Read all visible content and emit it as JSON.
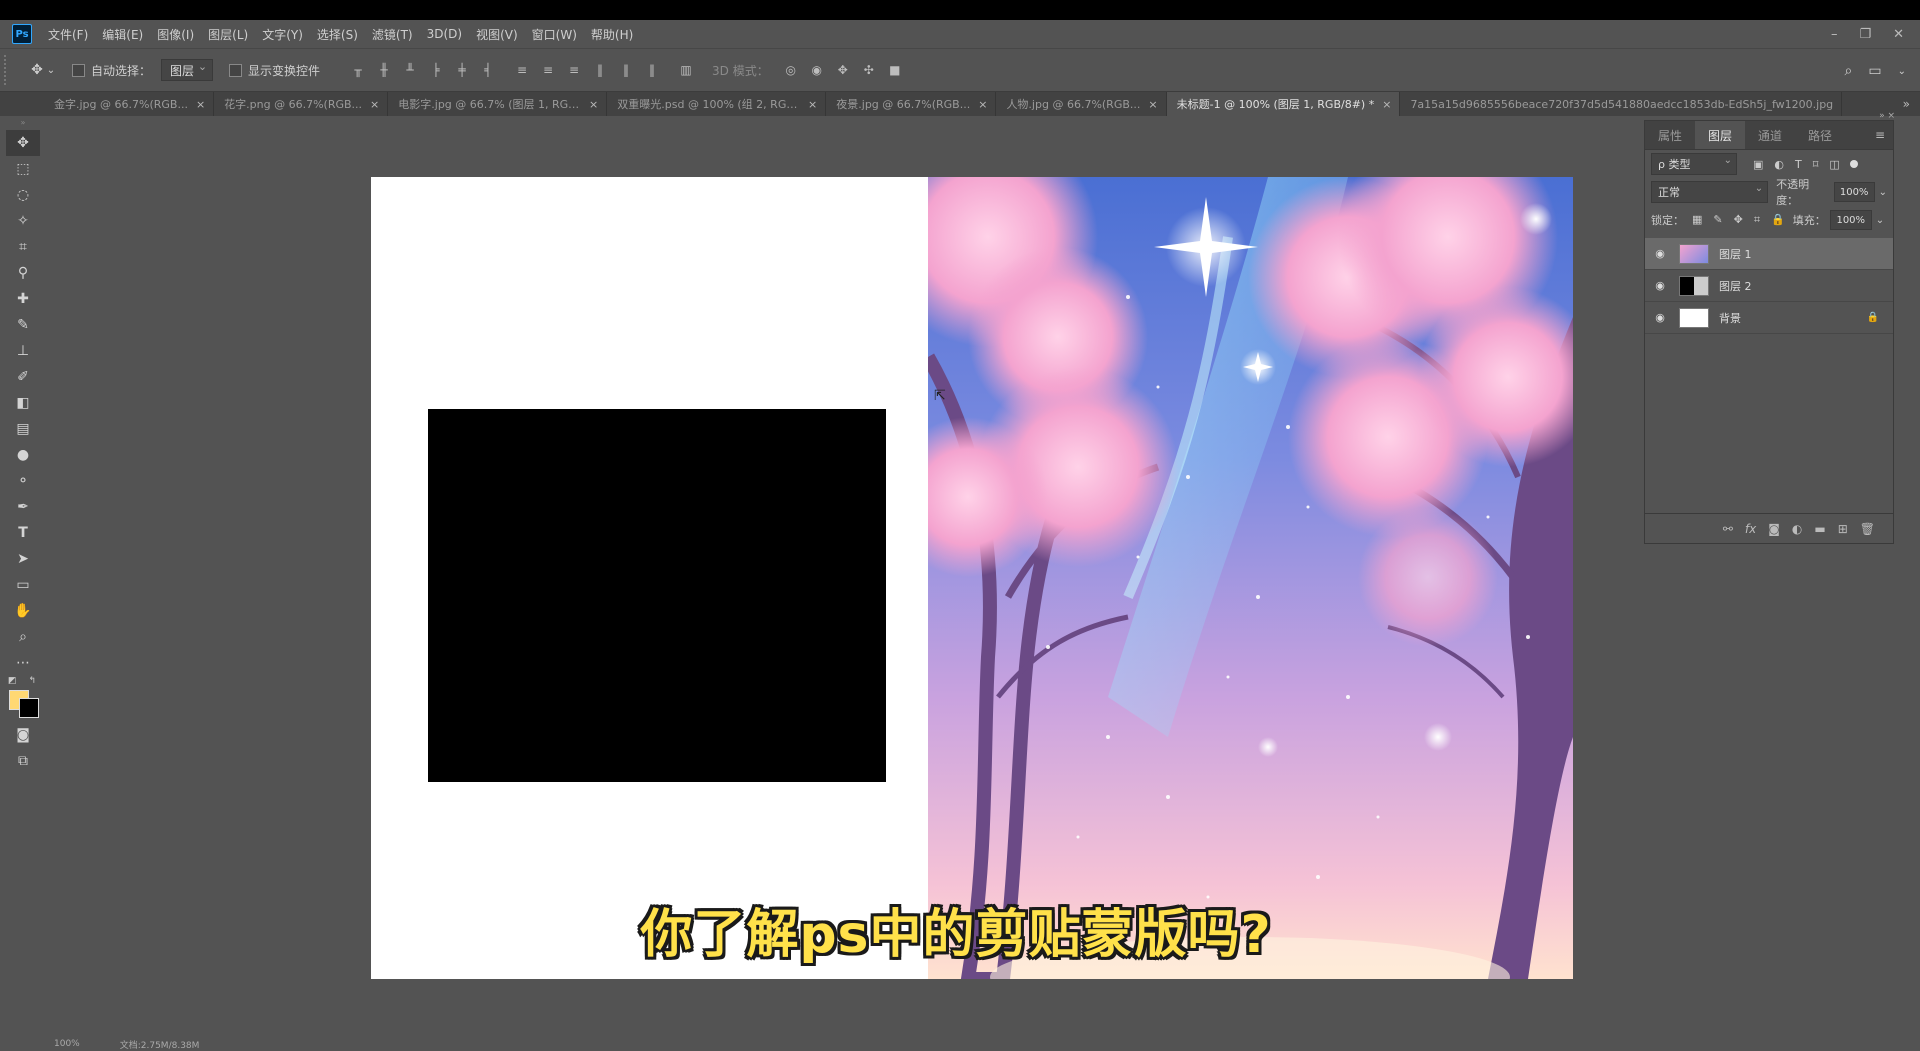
{
  "app": {
    "logo": "Ps"
  },
  "menu": [
    "文件(F)",
    "编辑(E)",
    "图像(I)",
    "图层(L)",
    "文字(Y)",
    "选择(S)",
    "滤镜(T)",
    "3D(D)",
    "视图(V)",
    "窗口(W)",
    "帮助(H)"
  ],
  "window_controls": {
    "minimize": "–",
    "restore": "❐",
    "close": "✕"
  },
  "options": {
    "auto_select_label": "自动选择：",
    "auto_select_value": "图层",
    "show_transform_label": "显示变换控件",
    "mode_3d_label": "3D 模式："
  },
  "tabs": [
    {
      "label": "金字.jpg @ 66.7%(RGB...",
      "active": false
    },
    {
      "label": "花字.png @ 66.7%(RGB...",
      "active": false
    },
    {
      "label": "电影字.jpg @ 66.7% (图层 1, RGB/8...",
      "active": false
    },
    {
      "label": "双重曝光.psd @ 100% (组 2, RGB/8...",
      "active": false
    },
    {
      "label": "夜景.jpg @ 66.7%(RGB...",
      "active": false
    },
    {
      "label": "人物.jpg @ 66.7%(RGB...",
      "active": false
    },
    {
      "label": "未标题-1 @ 100% (图层 1, RGB/8#) *",
      "active": true
    },
    {
      "label": "7a15a15d9685556beace720f37d5d541880aedcc1853db-EdSh5j_fw1200.jpg",
      "active": false
    }
  ],
  "panel": {
    "tabs": [
      "属性",
      "图层",
      "通道",
      "路径"
    ],
    "active_tab": 1,
    "filter_kind": "ρ 类型",
    "blend_mode": "正常",
    "opacity_label": "不透明度：",
    "opacity_value": "100%",
    "lock_label": "锁定：",
    "fill_label": "填充：",
    "fill_value": "100%",
    "layers": [
      {
        "name": "图层 1",
        "selected": true
      },
      {
        "name": "图层 2",
        "selected": false
      },
      {
        "name": "背景",
        "selected": false,
        "locked": true
      }
    ]
  },
  "subtitle": "你了解ps中的剪贴蒙版吗?",
  "status": {
    "zoom": "100%",
    "doc": "文档:2.75M/8.38M"
  },
  "colors": {
    "foreground": "#ffd873",
    "background": "#000000",
    "ui_bg": "#535353",
    "accent_text": "#ffe14a"
  }
}
